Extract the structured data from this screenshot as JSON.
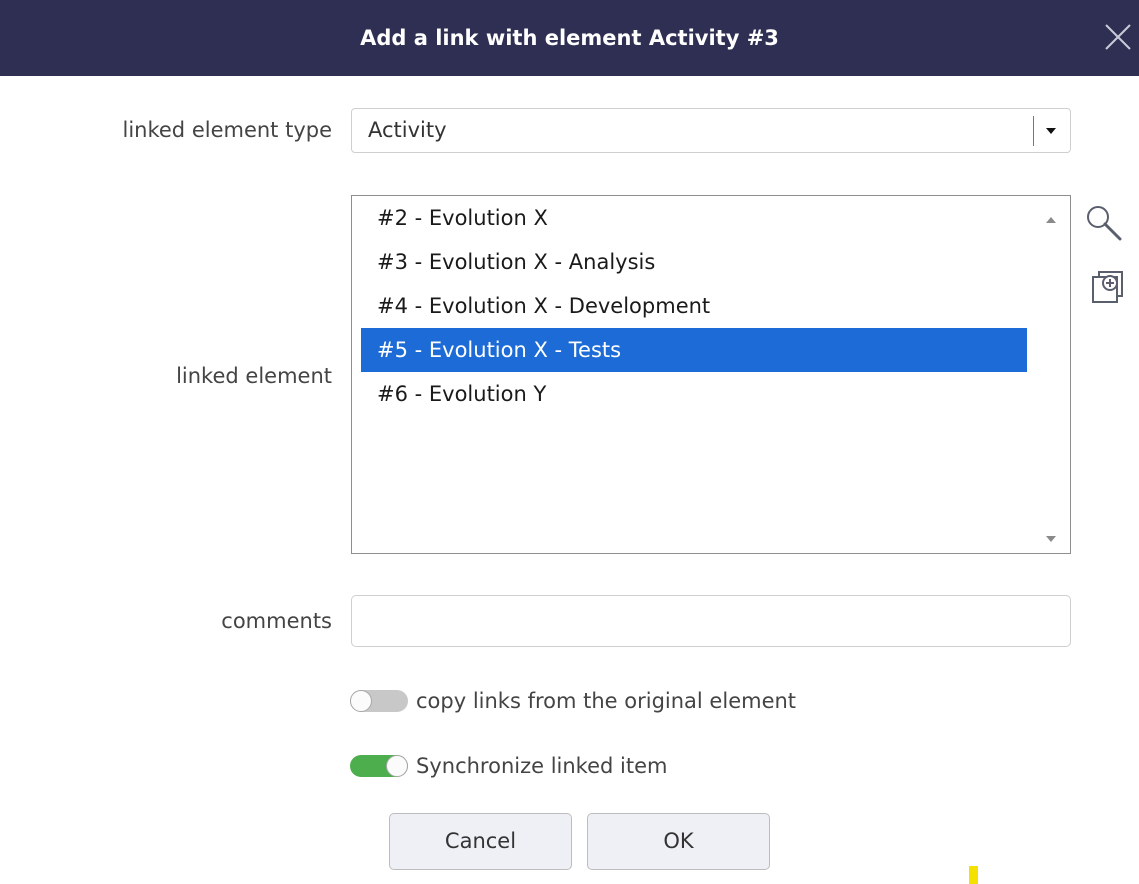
{
  "dialog": {
    "title": "Add a link with element Activity #3",
    "close_icon": "close-icon"
  },
  "linked_element_type": {
    "label": "linked element type",
    "value": "Activity"
  },
  "linked_element": {
    "label": "linked element",
    "items": [
      {
        "label": "#2 - Evolution X",
        "selected": false
      },
      {
        "label": "#3 - Evolution X - Analysis",
        "selected": false
      },
      {
        "label": "#4 - Evolution X - Development",
        "selected": false
      },
      {
        "label": "#5 - Evolution X - Tests",
        "selected": true
      },
      {
        "label": "#6 - Evolution Y",
        "selected": false
      }
    ],
    "search_icon": "search-icon",
    "add_icon": "add-element-icon"
  },
  "comments": {
    "label": "comments",
    "value": "",
    "placeholder": ""
  },
  "toggles": {
    "copy_links": {
      "label": "copy links from the original element",
      "on": false
    },
    "synchronize": {
      "label": "Synchronize linked item",
      "on": true
    }
  },
  "buttons": {
    "cancel": "Cancel",
    "ok": "OK"
  },
  "colors": {
    "header_bg": "#2e2f52",
    "selection": "#1d6bd6",
    "toggle_on": "#4cae4c",
    "toggle_off": "#c8c8c8"
  }
}
